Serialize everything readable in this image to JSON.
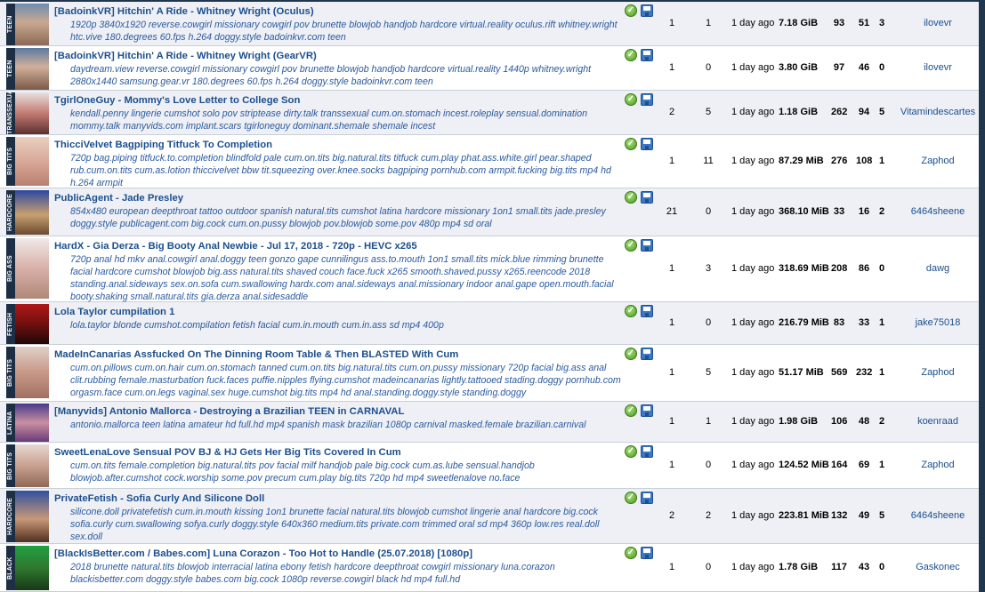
{
  "torrents": [
    {
      "category": "TEEN",
      "title": "[BadoinkVR] Hitchin' A Ride - Whitney Wright (Oculus)",
      "tags": "1920p 3840x1920 reverse.cowgirl missionary cowgirl pov brunette blowjob handjob hardcore virtual.reality oculus.rift whitney.wright htc.vive 180.degrees 60.fps h.264 doggy.style badoinkvr.com teen",
      "files": "1",
      "comments": "1",
      "time": "1 day ago",
      "size": "7.18 GiB",
      "snatches": "93",
      "seeders": "51",
      "leechers": "3",
      "uploader": "ilovevr"
    },
    {
      "category": "TEEN",
      "title": "[BadoinkVR] Hitchin' A Ride - Whitney Wright (GearVR)",
      "tags": "daydream.view reverse.cowgirl missionary cowgirl pov brunette blowjob handjob hardcore virtual.reality 1440p whitney.wright 2880x1440 samsung.gear.vr 180.degrees 60.fps h.264 doggy.style badoinkvr.com teen",
      "files": "1",
      "comments": "0",
      "time": "1 day ago",
      "size": "3.80 GiB",
      "snatches": "97",
      "seeders": "46",
      "leechers": "0",
      "uploader": "ilovevr"
    },
    {
      "category": "TRANSSEXUAL",
      "title": "TgirlOneGuy - Mommy's Love Letter to College Son",
      "tags": "kendall.penny lingerie cumshot solo pov striptease dirty.talk transsexual cum.on.stomach incest.roleplay sensual.domination mommy.talk manyvids.com implant.scars tgirloneguy dominant.shemale shemale incest",
      "files": "2",
      "comments": "5",
      "time": "1 day ago",
      "size": "1.18 GiB",
      "snatches": "262",
      "seeders": "94",
      "leechers": "5",
      "uploader": "Vitamindescartes"
    },
    {
      "category": "BIG TITS",
      "title": "ThicciVelvet Bagpiping Titfuck To Completion",
      "tags": "720p bag.piping titfuck.to.completion blindfold pale cum.on.tits big.natural.tits titfuck cum.play phat.ass.white.girl pear.shaped rub.cum.on.tits cum.as.lotion thiccivelvet bbw tit.squeezing over.knee.socks bagpiping pornhub.com armpit.fucking big.tits mp4 hd h.264 armpit",
      "files": "1",
      "comments": "11",
      "time": "1 day ago",
      "size": "87.29 MiB",
      "snatches": "276",
      "seeders": "108",
      "leechers": "1",
      "uploader": "Zaphod"
    },
    {
      "category": "HARDCORE",
      "title": "PublicAgent - Jade Presley",
      "tags": "854x480 european deepthroat tattoo outdoor spanish natural.tits cumshot latina hardcore missionary 1on1 small.tits jade.presley doggy.style publicagent.com big.cock cum.on.pussy blowjob pov.blowjob some.pov 480p mp4 sd oral",
      "files": "21",
      "comments": "0",
      "time": "1 day ago",
      "size": "368.10 MiB",
      "snatches": "33",
      "seeders": "16",
      "leechers": "2",
      "uploader": "6464sheene"
    },
    {
      "category": "BIG ASS",
      "title": "HardX - Gia Derza - Big Booty Anal Newbie - Jul 17, 2018 - 720p - HEVC x265",
      "tags": "720p anal hd mkv anal.cowgirl anal.doggy teen gonzo gape cunnilingus ass.to.mouth 1on1 small.tits mick.blue rimming brunette facial hardcore cumshot blowjob big.ass natural.tits shaved couch face.fuck x265 smooth.shaved.pussy x265.reencode 2018 standing.anal.sideways sex.on.sofa cum.swallowing hardx.com anal.sideways anal.missionary indoor anal.gape open.mouth.facial booty.shaking small.natural.tits gia.derza anal.sidesaddle",
      "files": "1",
      "comments": "3",
      "time": "1 day ago",
      "size": "318.69 MiB",
      "snatches": "208",
      "seeders": "86",
      "leechers": "0",
      "uploader": "dawg"
    },
    {
      "category": "FETISH",
      "title": "Lola Taylor cumpilation 1",
      "tags": "lola.taylor blonde cumshot.compilation fetish facial cum.in.mouth cum.in.ass sd mp4 400p",
      "files": "1",
      "comments": "0",
      "time": "1 day ago",
      "size": "216.79 MiB",
      "snatches": "83",
      "seeders": "33",
      "leechers": "1",
      "uploader": "jake75018"
    },
    {
      "category": "BIG TITS",
      "title": "MadeInCanarias Assfucked On The Dinning Room Table & Then BLASTED With Cum",
      "tags": "cum.on.pillows cum.on.hair cum.on.stomach tanned cum.on.tits big.natural.tits cum.on.pussy missionary 720p facial big.ass anal clit.rubbing female.masturbation fuck.faces puffie.nipples flying.cumshot madeincanarias lightly.tattooed stading.doggy pornhub.com orgasm.face cum.on.legs vaginal.sex huge.cumshot big.tits mp4 hd anal.standing.doggy.style standing.doggy",
      "files": "1",
      "comments": "5",
      "time": "1 day ago",
      "size": "51.17 MiB",
      "snatches": "569",
      "seeders": "232",
      "leechers": "1",
      "uploader": "Zaphod"
    },
    {
      "category": "LATINA",
      "title": "[Manyvids] Antonio Mallorca - Destroying a Brazilian TEEN in CARNAVAL",
      "tags": "antonio.mallorca teen latina amateur hd full.hd mp4 spanish mask brazilian 1080p carnival masked.female brazilian.carnival",
      "files": "1",
      "comments": "1",
      "time": "1 day ago",
      "size": "1.98 GiB",
      "snatches": "106",
      "seeders": "48",
      "leechers": "2",
      "uploader": "koenraad"
    },
    {
      "category": "BIG TITS",
      "title": "SweetLenaLove Sensual POV BJ & HJ Gets Her Big Tits Covered In Cum",
      "tags": "cum.on.tits female.completion big.natural.tits pov facial milf handjob pale big.cock cum.as.lube sensual.handjob blowjob.after.cumshot cock.worship some.pov precum cum.play big.tits 720p hd mp4 sweetlenalove no.face",
      "files": "1",
      "comments": "0",
      "time": "1 day ago",
      "size": "124.52 MiB",
      "snatches": "164",
      "seeders": "69",
      "leechers": "1",
      "uploader": "Zaphod"
    },
    {
      "category": "HARDCORE",
      "title": "PrivateFetish - Sofia Curly And Silicone Doll",
      "tags": "silicone.doll privatefetish cum.in.mouth kissing 1on1 brunette facial natural.tits blowjob cumshot lingerie anal hardcore big.cock sofia.curly cum.swallowing sofya.curly doggy.style 640x360 medium.tits private.com trimmed oral sd mp4 360p low.res real.doll sex.doll",
      "files": "2",
      "comments": "2",
      "time": "1 day ago",
      "size": "223.81 MiB",
      "snatches": "132",
      "seeders": "49",
      "leechers": "5",
      "uploader": "6464sheene"
    },
    {
      "category": "BLACK",
      "title": "[BlackIsBetter.com / Babes.com] Luna Corazon - Too Hot to Handle (25.07.2018) [1080p]",
      "tags": "2018 brunette natural.tits blowjob interracial latina ebony fetish hardcore deepthroat cowgirl missionary luna.corazon blackisbetter.com doggy.style babes.com big.cock 1080p reverse.cowgirl black hd mp4 full.hd",
      "files": "1",
      "comments": "0",
      "time": "1 day ago",
      "size": "1.78 GiB",
      "snatches": "117",
      "seeders": "43",
      "leechers": "0",
      "uploader": "Gaskonec"
    }
  ]
}
